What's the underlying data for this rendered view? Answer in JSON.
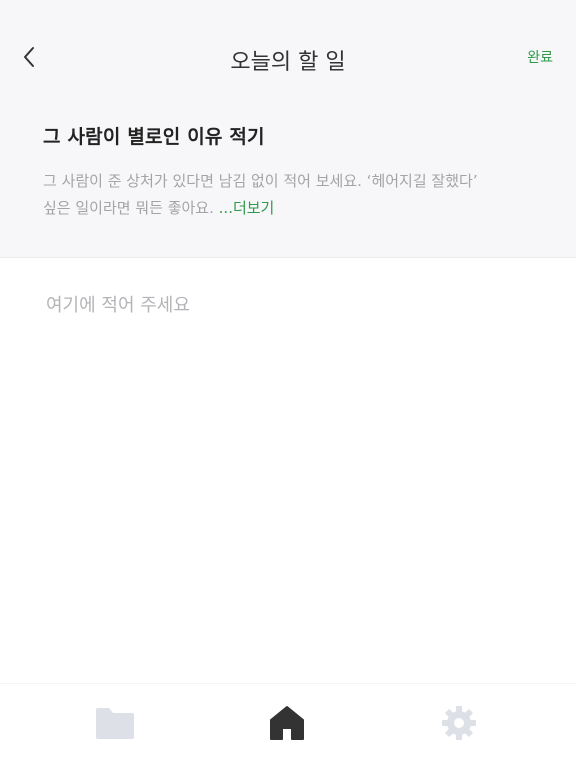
{
  "header": {
    "title": "오늘의 할 일",
    "done_label": "완료",
    "back_icon": "chevron-left-icon"
  },
  "task": {
    "heading": "그 사람이 별로인 이유 적기",
    "description_line1": "그 사람이 준 상처가 있다면 남김 없이 적어 보세요. ‘헤어지길 잘했다’",
    "description_line2": "싶은 일이라면 뭐든 좋아요. ",
    "more_label": "...더보기"
  },
  "editor": {
    "placeholder": "여기에 적어 주세요",
    "value": ""
  },
  "bottom_nav": {
    "items": [
      {
        "icon": "folder-icon",
        "active": false
      },
      {
        "icon": "home-icon",
        "active": true
      },
      {
        "icon": "gear-icon",
        "active": false
      }
    ]
  },
  "colors": {
    "accent": "#2f9a4c",
    "header_bg": "#f7f7f9",
    "muted_text": "#a4a4a8",
    "inactive_icon": "#dde0e6",
    "active_icon": "#333333"
  }
}
